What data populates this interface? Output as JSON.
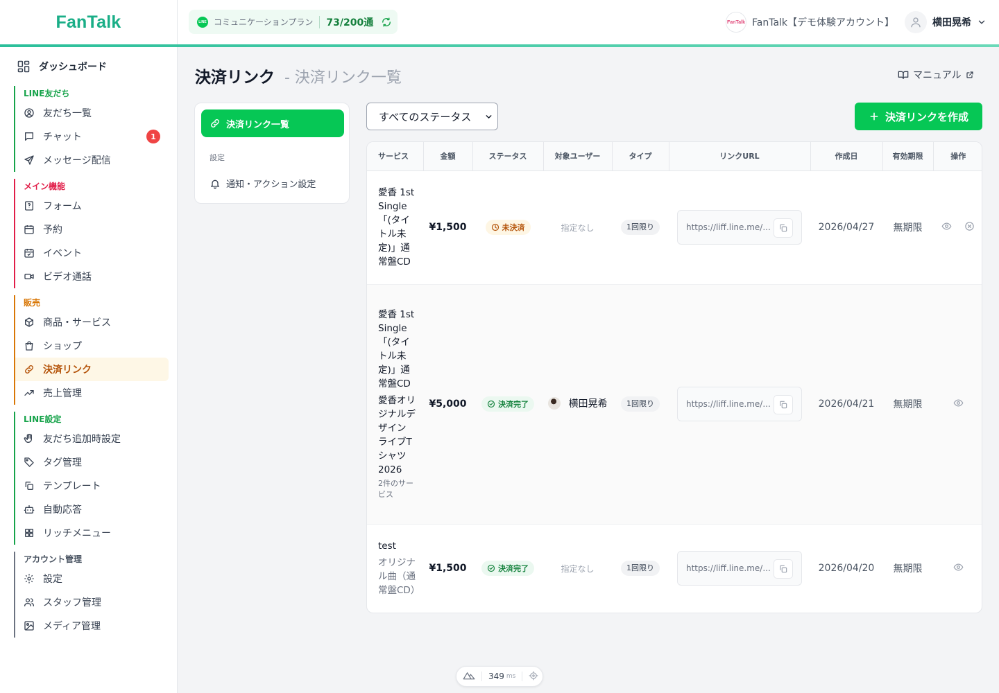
{
  "brand": {
    "logo_text": "FanTalk",
    "accent": "#06c755",
    "teal": "#1aae87"
  },
  "plan": {
    "line_badge": "LINE",
    "name": "コミュニケーションプラン",
    "count": "73/200通"
  },
  "account": {
    "avatar_line1": "Fan",
    "avatar_line2": "Talk",
    "name": "FanTalk【デモ体験アカウント】"
  },
  "user": {
    "name": "横田晃希"
  },
  "sidebar": {
    "dashboard": "ダッシュボード",
    "groups": [
      {
        "title": "LINE友だち",
        "color": "#16a34a",
        "items": [
          {
            "label": "友だち一覧",
            "icon": "user-circle-icon"
          },
          {
            "label": "チャット",
            "icon": "chat-icon",
            "badge": "1"
          },
          {
            "label": "メッセージ配信",
            "icon": "send-icon"
          }
        ]
      },
      {
        "title": "メイン機能",
        "color": "#e11d48",
        "items": [
          {
            "label": "フォーム",
            "icon": "form-icon"
          },
          {
            "label": "予約",
            "icon": "calendar-icon"
          },
          {
            "label": "イベント",
            "icon": "calendar-check-icon"
          },
          {
            "label": "ビデオ通話",
            "icon": "video-icon"
          }
        ]
      },
      {
        "title": "販売",
        "color": "#d97706",
        "items": [
          {
            "label": "商品・サービス",
            "icon": "box-icon"
          },
          {
            "label": "ショップ",
            "icon": "shopping-bag-icon"
          },
          {
            "label": "決済リンク",
            "icon": "link-icon",
            "active": true
          },
          {
            "label": "売上管理",
            "icon": "trending-up-icon"
          }
        ]
      },
      {
        "title": "LINE設定",
        "color": "#16a34a",
        "items": [
          {
            "label": "友だち追加時設定",
            "icon": "hand-icon"
          },
          {
            "label": "タグ管理",
            "icon": "tag-icon"
          },
          {
            "label": "テンプレート",
            "icon": "copy-icon"
          },
          {
            "label": "自動応答",
            "icon": "bot-icon"
          },
          {
            "label": "リッチメニュー",
            "icon": "grid-icon"
          }
        ]
      },
      {
        "title": "アカウント管理",
        "color": "#4b5563",
        "items": [
          {
            "label": "設定",
            "icon": "gear-icon"
          },
          {
            "label": "スタッフ管理",
            "icon": "users-icon"
          },
          {
            "label": "メディア管理",
            "icon": "image-icon"
          }
        ]
      }
    ]
  },
  "page": {
    "title": "決済リンク",
    "subtitle": "- 決済リンク一覧",
    "manual": "マニュアル"
  },
  "subnav": {
    "active": "決済リンク一覧",
    "section_label": "設定",
    "item": "通知・アクション設定"
  },
  "filter": {
    "selected": "すべてのステータス"
  },
  "create_button": "決済リンクを作成",
  "table": {
    "headers": [
      "サービス",
      "金額",
      "ステータス",
      "対象ユーザー",
      "タイプ",
      "リンクURL",
      "作成日",
      "有効期限",
      "操作"
    ],
    "rows": [
      {
        "service": "愛香 1st Single 「(タイトル未定)」通常盤CD",
        "amount": "¥1,500",
        "status": "未決済",
        "target": "指定なし",
        "type": "1回限り",
        "url": "https://liff.line.me/...",
        "created": "2026/04/27",
        "expiry": "無期限"
      },
      {
        "service": "愛香 1st Single 「(タイトル未定)」通常盤CD",
        "service2": "愛香オリジナルデザイン ライブTシャツ2026",
        "service_note": "2件のサービス",
        "amount": "¥5,000",
        "status": "決済完了",
        "target": "横田晃希",
        "type": "1回限り",
        "url": "https://liff.line.me/...",
        "created": "2026/04/21",
        "expiry": "無期限"
      },
      {
        "service": "test",
        "service2": "オリジナル曲（通常盤CD）",
        "amount": "¥1,500",
        "status": "決済完了",
        "target": "指定なし",
        "type": "1回限り",
        "url": "https://liff.line.me/...",
        "created": "2026/04/20",
        "expiry": "無期限"
      }
    ]
  },
  "perf": {
    "value": "349",
    "unit": "ms"
  }
}
